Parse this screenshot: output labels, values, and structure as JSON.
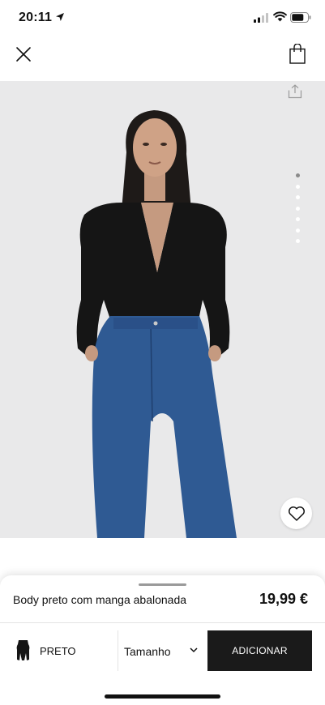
{
  "status": {
    "time": "20:11"
  },
  "icons": {
    "location": "location-arrow-icon",
    "signal": "cellular-signal-icon",
    "wifi": "wifi-icon",
    "battery": "battery-icon",
    "close": "close-icon",
    "bag": "shopping-bag-icon",
    "share": "share-icon",
    "favorite": "heart-icon",
    "size_dropdown": "chevron-down-icon",
    "color_swatch": "garment-swatch-icon"
  },
  "gallery": {
    "total_images": 7,
    "active_index": 0
  },
  "product": {
    "name": "Body preto com manga abalonada",
    "price": "19,99 €",
    "color": "PRETO",
    "size_placeholder": "Tamanho",
    "add_label": "ADICIONAR"
  },
  "colors": {
    "image_bg": "#e9e9ea",
    "button_bg": "#1a1a1a",
    "top": "#151515",
    "jeans": "#2f5a93"
  }
}
